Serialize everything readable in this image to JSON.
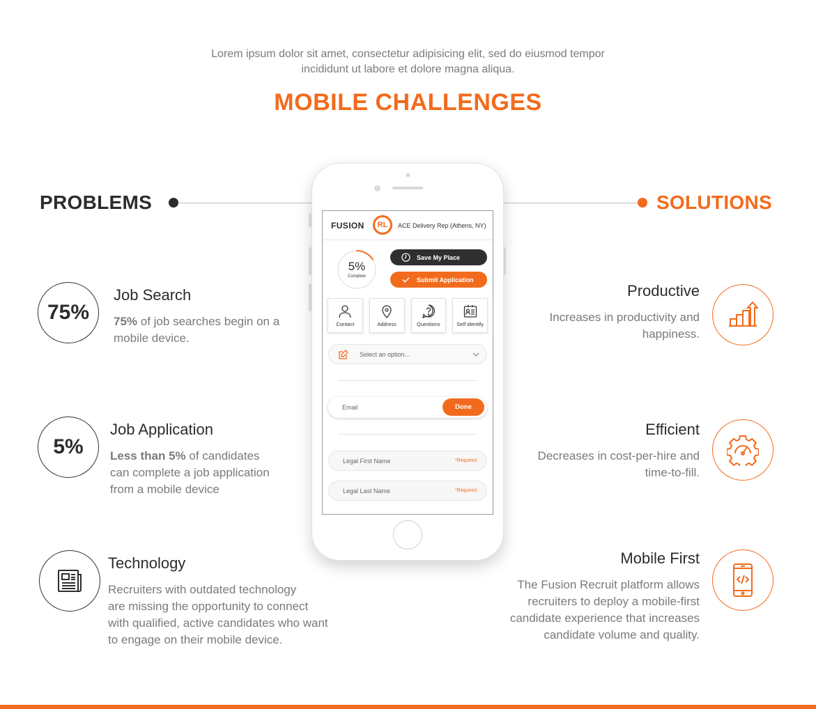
{
  "intro": {
    "line1": "Lorem ipsum dolor sit amet, consectetur adipisicing elit, sed do eiusmod tempor",
    "line2": "incididunt ut labore et dolore magna aliqua."
  },
  "title": "MOBILE CHALLENGES",
  "problems": {
    "heading": "PROBLEMS",
    "items": [
      {
        "stat": "75%",
        "title": "Job Search",
        "text_bold": "75%",
        "text_line1": " of job searches begin on a",
        "text_line2": "mobile device."
      },
      {
        "stat": "5%",
        "title": "Job Application",
        "text_bold": "Less than 5%",
        "text_line1": " of candidates",
        "text_line2": "can complete a job application",
        "text_line3": "from a mobile device"
      },
      {
        "icon": "newspaper-icon",
        "title": "Technology",
        "text_line1": "Recruiters with outdated technology",
        "text_line2": "are missing the opportunity to connect",
        "text_line3": "with qualified, active candidates who want",
        "text_line4": "to engage on their mobile device."
      }
    ]
  },
  "solutions": {
    "heading": "SOLUTIONS",
    "items": [
      {
        "icon": "growth-chart-icon",
        "title": "Productive",
        "text_line1": "Increases in productivity and",
        "text_line2": "happiness."
      },
      {
        "icon": "gauge-gear-icon",
        "title": "Efficient",
        "text_line1": "Decreases in cost-per-hire and",
        "text_line2": "time-to-fill."
      },
      {
        "icon": "mobile-code-icon",
        "title": "Mobile First",
        "text_line1": "The Fusion Recruit platform allows",
        "text_line2": "recruiters to deploy a mobile-first",
        "text_line3": "candidate experience that increases",
        "text_line4": "candidate volume and quality."
      }
    ]
  },
  "phone": {
    "logo_text": "FUSION",
    "logo_mark": "RL",
    "job_title": "ACE Delivery Rep (Athens, NY)",
    "progress_value": 0.05,
    "progress_label": "5%",
    "progress_sub": "Complete",
    "save_label": "Save My Place",
    "submit_label": "Submit Application",
    "tabs": [
      {
        "label": "Contact",
        "icon": "person-icon"
      },
      {
        "label": "Address",
        "icon": "map-pin-icon"
      },
      {
        "label": "Questions",
        "icon": "question-icon"
      },
      {
        "label": "Self identify",
        "icon": "id-card-icon"
      }
    ],
    "select_placeholder": "Select an option...",
    "email_placeholder": "Email",
    "done_label": "Done",
    "first_name_placeholder": "Legal First Name",
    "last_name_placeholder": "Legal Last Name",
    "required_label": "*Required"
  },
  "colors": {
    "accent": "#f26b1d",
    "dark": "#2c2c2c",
    "muted": "#7a7a7a"
  }
}
